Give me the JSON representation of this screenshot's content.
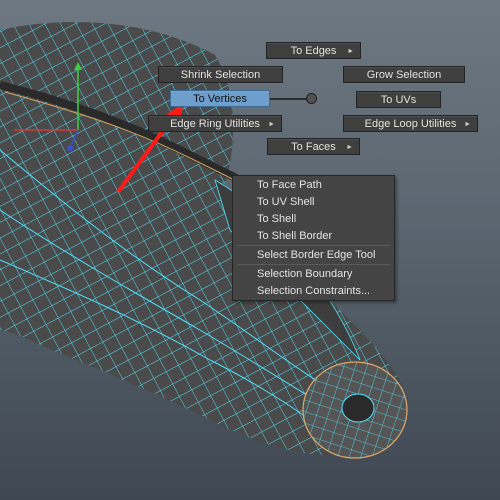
{
  "marking_menu": {
    "north": "To Edges",
    "northwest": "Shrink Selection",
    "northeast": "Grow Selection",
    "west": "To Vertices",
    "east": "To UVs",
    "southwest": "Edge Ring Utilities",
    "southeast": "Edge Loop Utilities",
    "south": "To Faces"
  },
  "context_menu": {
    "items": [
      "To Face Path",
      "To UV Shell",
      "To Shell",
      "To Shell Border",
      "Select Border Edge Tool",
      "Selection Boundary",
      "Selection Constraints..."
    ]
  },
  "colors": {
    "wireframe": "#4fe3ff",
    "menu_bg": "#3f3f3f",
    "highlight": "#6d9ecc",
    "annotation_arrow": "#ff1a1a"
  },
  "icons": {
    "submenu": "triangle-right",
    "annotation": "red-arrow"
  }
}
